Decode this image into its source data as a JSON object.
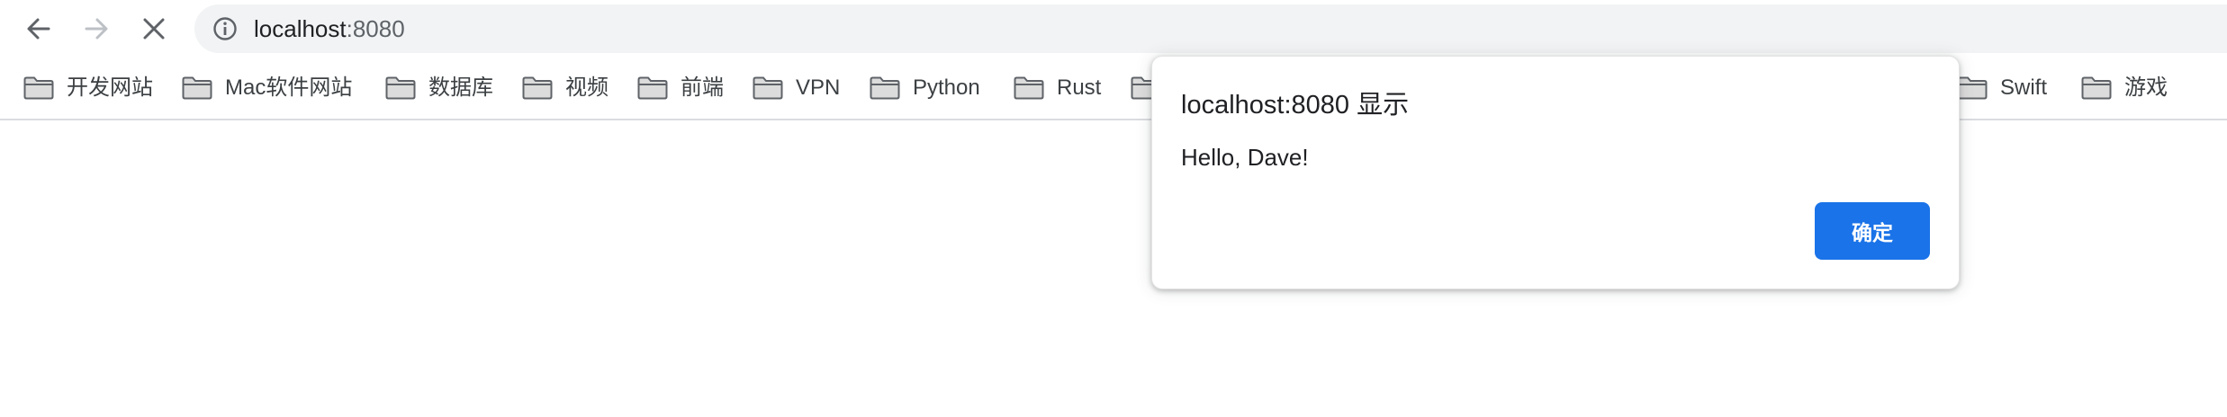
{
  "browser": {
    "nav": {
      "back_icon": "arrow-left-icon",
      "forward_icon": "arrow-right-icon",
      "stop_icon": "close-icon"
    },
    "address_bar": {
      "info_icon": "info-icon",
      "host": "localhost",
      "port": ":8080"
    }
  },
  "bookmarks": {
    "folder_icon": "folder-icon",
    "items": [
      {
        "label": "开发网站"
      },
      {
        "label": "Mac软件网站"
      },
      {
        "label": "数据库"
      },
      {
        "label": "视频"
      },
      {
        "label": "前端"
      },
      {
        "label": "VPN"
      },
      {
        "label": "Python"
      },
      {
        "label": "Rust"
      },
      {
        "label": ""
      },
      {
        "label": "Swift"
      },
      {
        "label": "游戏"
      }
    ]
  },
  "dialog": {
    "title": "localhost:8080 显示",
    "message": "Hello, Dave!",
    "ok_label": "确定",
    "accent_color": "#1a73e8"
  }
}
